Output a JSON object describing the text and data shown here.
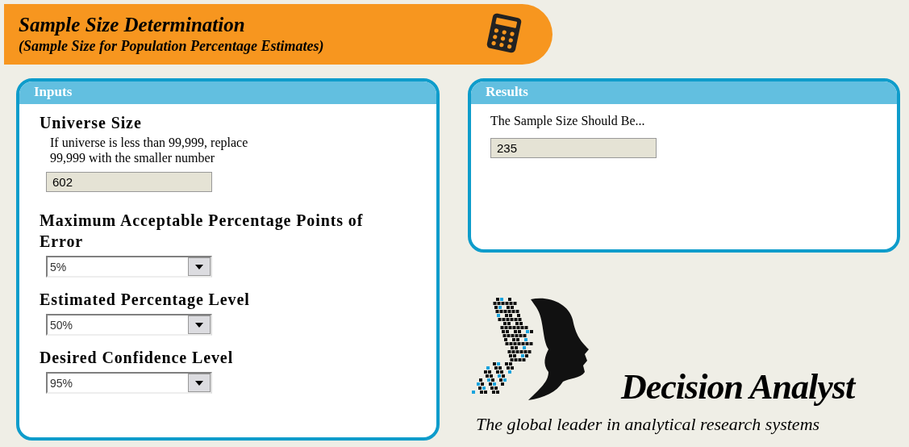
{
  "header": {
    "title": "Sample Size Determination",
    "subtitle": "(Sample Size for Population Percentage Estimates)"
  },
  "inputs": {
    "title": "Inputs",
    "fields": [
      {
        "kind": "text",
        "label": "Universe Size",
        "hint": "If universe is less than 99,999, replace 99,999 with the smaller number",
        "value": "602"
      },
      {
        "kind": "select",
        "label": "Maximum Acceptable Percentage Points of Error",
        "value": "5%"
      },
      {
        "kind": "select",
        "label": "Estimated Percentage Level",
        "value": "50%"
      },
      {
        "kind": "select",
        "label": "Desired Confidence Level",
        "value": "95%"
      }
    ]
  },
  "results": {
    "title": "Results",
    "label": "The Sample Size Should Be...",
    "value": "235"
  },
  "logo": {
    "name": "Decision Analyst",
    "tagline": "The global leader in analytical research systems"
  }
}
